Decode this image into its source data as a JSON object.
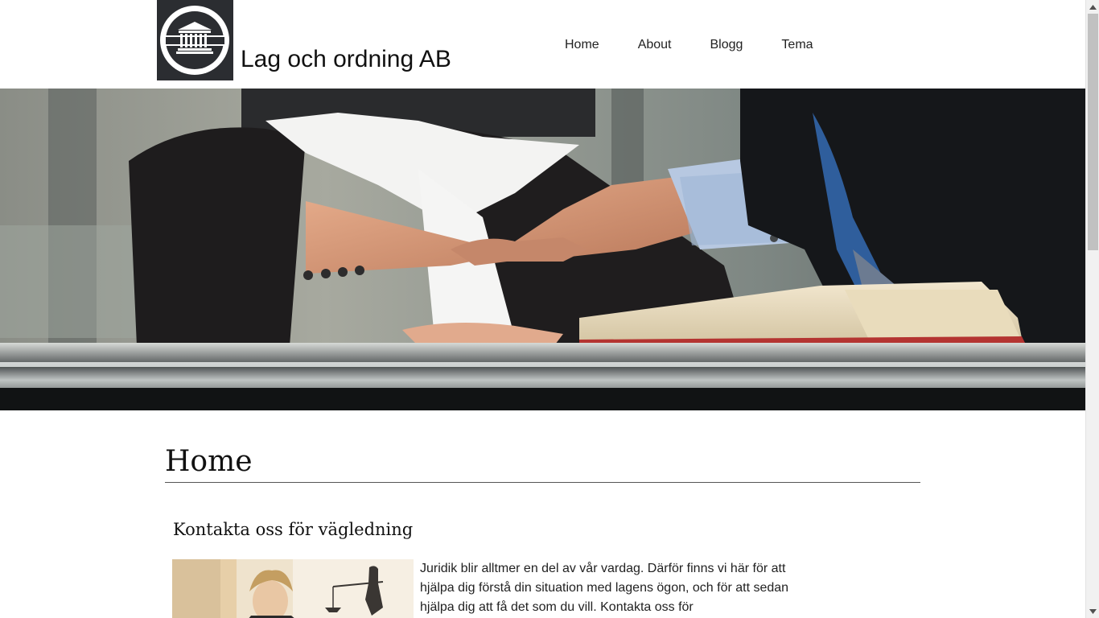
{
  "header": {
    "logo_icon": "courthouse-icon",
    "site_title": "Lag och ordning AB",
    "nav": [
      {
        "label": "Home"
      },
      {
        "label": "About"
      },
      {
        "label": "Blogg"
      },
      {
        "label": "Tema"
      }
    ]
  },
  "hero": {
    "image": "handshake-over-desk-photo"
  },
  "main": {
    "page_heading": "Home",
    "section_heading": "Kontakta oss för vägledning",
    "article_image": "lawyer-with-justice-statue-photo",
    "article_text": "Juridik blir alltmer en del av vår vardag. Därför finns vi här för att hjälpa dig förstå din situation med lagens ögon, och för att sedan hjälpa dig att få det som du vill. Kontakta oss för"
  },
  "colors": {
    "logo_bg": "#2b2d31",
    "text": "#111111",
    "scrollbar_track": "#f1f1f1",
    "scrollbar_thumb": "#c1c1c1"
  },
  "scrollbar": {
    "up_icon": "arrow-up-icon",
    "down_icon": "arrow-down-icon"
  }
}
